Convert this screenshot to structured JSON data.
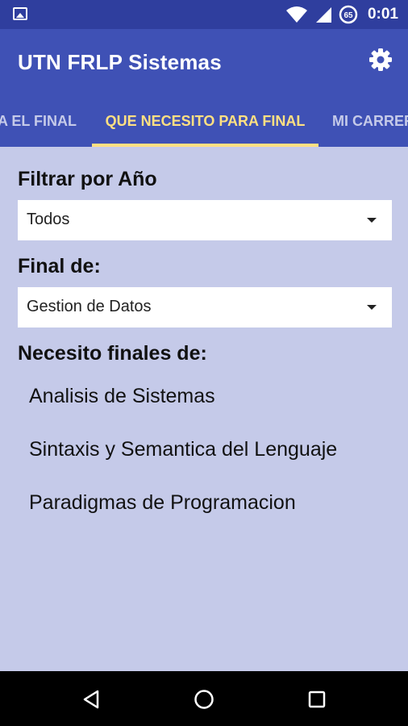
{
  "status_bar": {
    "time": "0:01",
    "battery_level": "65",
    "icons": [
      "image-icon",
      "wifi-icon",
      "signal-icon",
      "battery-saver-icon"
    ]
  },
  "app_bar": {
    "title": "UTN FRLP Sistemas",
    "settings_icon": "gear-icon"
  },
  "tabs": [
    {
      "label": "A EL FINAL",
      "selected": false
    },
    {
      "label": "QUE NECESITO PARA FINAL",
      "selected": true
    },
    {
      "label": "MI CARRER",
      "selected": false
    }
  ],
  "filter": {
    "label": "Filtrar por Año",
    "selected": "Todos"
  },
  "final": {
    "label": "Final de:",
    "selected": "Gestion de Datos"
  },
  "needed": {
    "label": "Necesito finales de:",
    "items": [
      "Analisis de Sistemas",
      "Sintaxis y Semantica del Lenguaje",
      "Paradigmas de Programacion"
    ]
  },
  "nav_bar": {
    "icons": [
      "back-icon",
      "home-icon",
      "recents-icon"
    ]
  },
  "colors": {
    "status_bar": "#2f3e9e",
    "primary": "#3f51b5",
    "accent": "#ffe082",
    "background": "#c5cae9"
  }
}
